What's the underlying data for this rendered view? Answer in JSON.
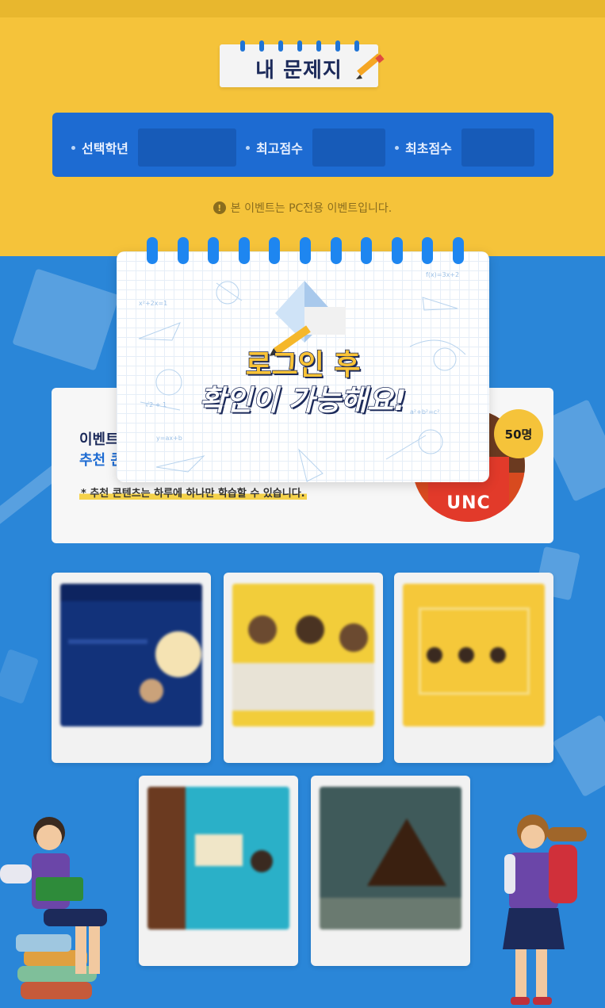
{
  "header": {
    "title": "내 문제지"
  },
  "filters": [
    {
      "label": "선택학년",
      "value": ""
    },
    {
      "label": "최고점수",
      "value": ""
    },
    {
      "label": "최초점수",
      "value": ""
    }
  ],
  "notice": {
    "icon": "info-icon",
    "text": "본 이벤트는 PC전용 이벤트입니다."
  },
  "event": {
    "title_partial": "이벤트",
    "subtitle_partial": "추천 콘",
    "note": "* 추천 콘텐츠는 하루에 하나만 학습할 수 있습니다.",
    "prize_text": "UNC",
    "winners": "50명"
  },
  "modal": {
    "line1": "로그인 후",
    "line2": "확인이 가능해요!"
  },
  "contents": [
    {
      "title": ""
    },
    {
      "title": ""
    },
    {
      "title": ""
    },
    {
      "title": ""
    },
    {
      "title": ""
    }
  ],
  "colors": {
    "yellow": "#f5c33a",
    "blue": "#2a86d8",
    "navy": "#1c2a5a",
    "accent_blue": "#1d6bd2"
  }
}
